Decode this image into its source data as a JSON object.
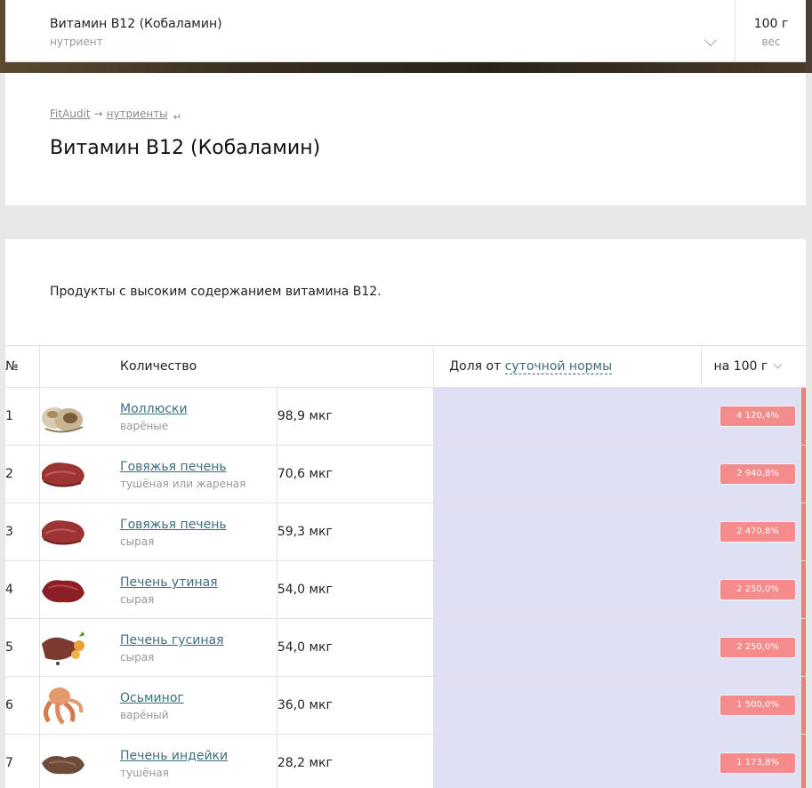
{
  "topbar": {
    "nutrient_title": "Витамин B12 (Кобаламин)",
    "nutrient_sub": "нутриент",
    "weight_value": "100 г",
    "weight_sub": "вес"
  },
  "breadcrumb": {
    "home": "FitAudit",
    "arrow": "→",
    "section": "нутриенты",
    "hook": "↵"
  },
  "page_title": "Витамин B12 (Кобаламин)",
  "intro": "Продукты с высоким содержанием витамина B12.",
  "table": {
    "col_num": "№",
    "col_amount": "Количество",
    "col_share_prefix": "Доля от",
    "col_share_link": "суточной нормы",
    "col_per": "на 100 г",
    "rows": [
      {
        "num": "1",
        "name": "Моллюски",
        "prep": "варёные",
        "amount": "98,9 мкг",
        "percent": "4 120,4%",
        "icon": "clams-image"
      },
      {
        "num": "2",
        "name": "Говяжья печень",
        "prep": "тушёная или жареная",
        "amount": "70,6 мкг",
        "percent": "2 940,8%",
        "icon": "beef-liver-image"
      },
      {
        "num": "3",
        "name": "Говяжья печень",
        "prep": "сырая",
        "amount": "59,3 мкг",
        "percent": "2 470,8%",
        "icon": "beef-liver-image"
      },
      {
        "num": "4",
        "name": "Печень утиная",
        "prep": "сырая",
        "amount": "54,0 мкг",
        "percent": "2 250,0%",
        "icon": "duck-liver-image"
      },
      {
        "num": "5",
        "name": "Печень гусиная",
        "prep": "сырая",
        "amount": "54,0 мкг",
        "percent": "2 250,0%",
        "icon": "goose-liver-image"
      },
      {
        "num": "6",
        "name": "Осьминог",
        "prep": "варёный",
        "amount": "36,0 мкг",
        "percent": "1 500,0%",
        "icon": "octopus-image"
      },
      {
        "num": "7",
        "name": "Печень индейки",
        "prep": "тушёная",
        "amount": "28,2 мкг",
        "percent": "1 173,8%",
        "icon": "turkey-liver-image"
      }
    ]
  },
  "colors": {
    "link": "#3d6f7f",
    "bar_bg": "#e0e0f5",
    "badge": "#f58b8b"
  }
}
